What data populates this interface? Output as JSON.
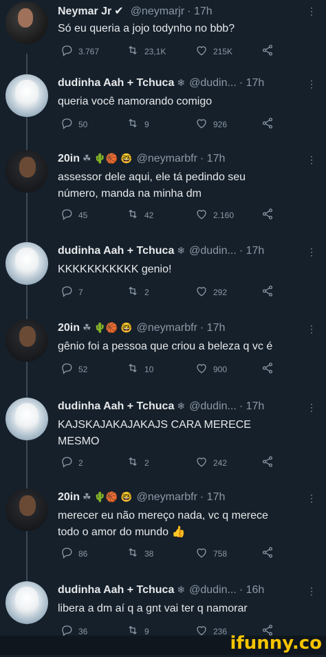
{
  "tweets": [
    {
      "name": "Neymar Jr",
      "handle": "@neymarjr",
      "time": "· 17h",
      "verified": true,
      "text": [
        "Só eu queria a jojo todynho no bbb?"
      ],
      "reply": "3.767",
      "retweet": "23,1K",
      "like": "215K",
      "avatar": "neymarjr"
    },
    {
      "name": "dudinha Aah + Tchuca",
      "badge": "❄",
      "handle": "@dudin...",
      "time": "· 17h",
      "text": [
        "queria você namorando comigo"
      ],
      "reply": "50",
      "retweet": "9",
      "like": "926",
      "avatar": "dudinha"
    },
    {
      "name": "20in",
      "badge": "☘ 🌵🏀 🤓",
      "handle": "@neymarbfr",
      "time": "· 17h",
      "text": [
        "assessor dele aqui, ele tá pedindo seu",
        "número, manda na minha dm"
      ],
      "reply": "45",
      "retweet": "42",
      "like": "2.160",
      "avatar": "neymarbfr"
    },
    {
      "name": "dudinha Aah + Tchuca",
      "badge": "❄",
      "handle": "@dudin...",
      "time": "· 17h",
      "text": [
        "KKKKKKKKKKK genio!"
      ],
      "reply": "7",
      "retweet": "2",
      "like": "292",
      "avatar": "dudinha"
    },
    {
      "name": "20in",
      "badge": "☘ 🌵🏀 🤓",
      "handle": "@neymarbfr",
      "time": "· 17h",
      "text": [
        "gênio foi a pessoa que criou a beleza q vc é"
      ],
      "reply": "52",
      "retweet": "10",
      "like": "900",
      "avatar": "neymarbfr"
    },
    {
      "name": "dudinha Aah + Tchuca",
      "badge": "❄",
      "handle": "@dudin...",
      "time": "· 17h",
      "text": [
        "KAJSKAJAKAJAKAJS CARA MERECE",
        "MESMO"
      ],
      "reply": "2",
      "retweet": "2",
      "like": "242",
      "avatar": "dudinha"
    },
    {
      "name": "20in",
      "badge": "☘ 🌵🏀 🤓",
      "handle": "@neymarbfr",
      "time": "· 17h",
      "text": [
        "merecer eu não mereço nada, vc q merece",
        "todo o amor do mundo 👍"
      ],
      "reply": "86",
      "retweet": "38",
      "like": "758",
      "avatar": "neymarbfr"
    },
    {
      "name": "dudinha Aah + Tchuca",
      "badge": "❄",
      "handle": "@dudin...",
      "time": "· 16h",
      "text": [
        "libera a dm aí q a gnt vai ter q namorar"
      ],
      "reply": "36",
      "retweet": "9",
      "like": "236",
      "avatar": "dudinha"
    }
  ],
  "watermark": "ifunny.co",
  "colors": {
    "background": "#15202b",
    "text": "#e7e9ea",
    "muted": "#8b98a5",
    "watermark": "#f5c400"
  },
  "icons": [
    "reply-icon",
    "retweet-icon",
    "like-icon",
    "share-icon",
    "verified-icon",
    "more-icon"
  ]
}
